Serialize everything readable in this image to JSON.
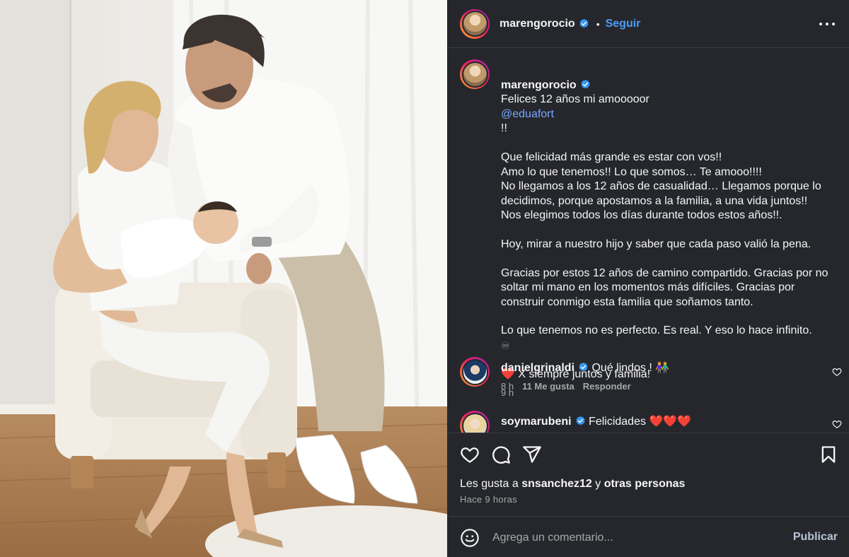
{
  "header": {
    "username": "marengorocio",
    "follow_label": "Seguir",
    "separator": "•"
  },
  "caption": {
    "username": "marengorocio",
    "first_line": "Felices 12 años mi amooooor",
    "mention": "@eduafort",
    "first_line_end": "!!",
    "paragraph_1": "Que felicidad más grande es estar con vos!!\nAmo lo que tenemos!! Lo que somos… Te amooo!!!!\nNo llegamos a los 12 años de casualidad… Llegamos porque lo decidimos, porque apostamos a la familia, a una vida juntos!!\nNos elegimos todos los días durante todos estos años!!.",
    "paragraph_2": "Hoy, mirar a nuestro hijo y saber que cada paso valió la pena.",
    "paragraph_3": "Gracias por estos 12 años de camino compartido. Gracias por no soltar mi mano en los momentos más difíciles. Gracias por construir conmigo esta familia que soñamos tanto.",
    "paragraph_4": "Lo que tenemos no es perfecto. Es real. Y eso lo hace infinito.",
    "infinity": "♾",
    "heart": "❤️",
    "closing": "X siempre juntos y familia!",
    "time": "9 h"
  },
  "comments": [
    {
      "username": "danielgrinaldi",
      "text": "Qué lindos !",
      "emoji": "👫",
      "time": "8 h",
      "likes": "11 Me gusta",
      "reply_label": "Responder"
    },
    {
      "username": "soymarubeni",
      "text": "Felicidades",
      "emoji": "❤️❤️❤️"
    }
  ],
  "actions": {
    "likes_prefix": "Les gusta a",
    "likes_user": "snsanchez12",
    "likes_joiner": "y",
    "likes_others": "otras personas",
    "ago": "Hace 9 horas"
  },
  "composer": {
    "placeholder": "Agrega un comentario...",
    "publish_label": "Publicar"
  },
  "colors": {
    "panel_bg": "#25272c",
    "link_blue": "#4f9cf6",
    "mention_blue": "#7aa7ff",
    "verified_blue": "#3897f0"
  },
  "icons": [
    "verified-badge-icon",
    "more-options-icon",
    "heart-icon",
    "comment-icon",
    "share-icon",
    "save-icon",
    "emoji-icon"
  ]
}
